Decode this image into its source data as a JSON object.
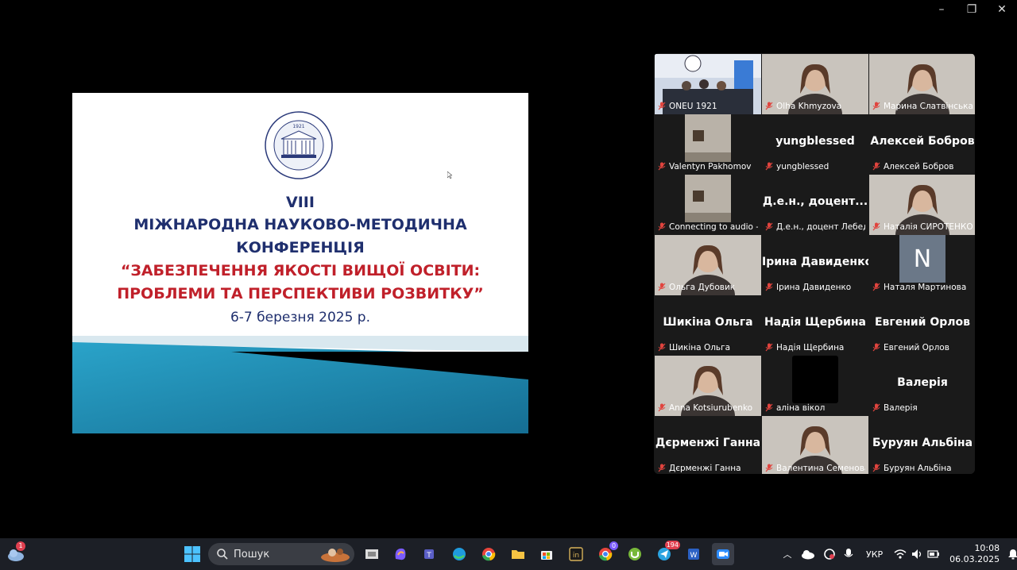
{
  "window": {
    "minimize": "–",
    "restore": "❐",
    "close": "✕"
  },
  "slide": {
    "line1": "VIII",
    "line2": "МІЖНАРОДНА НАУКОВО-МЕТОДИЧНА",
    "line3": "КОНФЕРЕНЦІЯ",
    "line4": "“ЗАБЕЗПЕЧЕННЯ ЯКОСТІ ВИЩОЇ ОСВІТИ:",
    "line5": "ПРОБЛЕМИ ТА ПЕРСПЕКТИВИ РОЗВИТКУ”",
    "line6": "6-7 березня 2025 р.",
    "seal_year": "1921"
  },
  "participants": [
    {
      "name": "ONEU 1921",
      "display": "",
      "video": "room"
    },
    {
      "name": "Olha Khmyzova",
      "display": "",
      "video": "person"
    },
    {
      "name": "Марина Слатвінська",
      "display": "",
      "video": "person"
    },
    {
      "name": "Valentyn Pakhomov",
      "display": "",
      "video": "small"
    },
    {
      "name": "yungblessed",
      "display": "yungblessed",
      "video": ""
    },
    {
      "name": "Алексей Бобров",
      "display": "Алексей Бобров",
      "video": ""
    },
    {
      "name": "Connecting to audio -...",
      "display": "",
      "video": "small"
    },
    {
      "name": "Д.е.н., доцент Лебеде...",
      "display": "Д.е.н., доцент...",
      "video": ""
    },
    {
      "name": "Наталія СИРОТЕНКО",
      "display": "",
      "video": "person"
    },
    {
      "name": "Ольга Дубовик",
      "display": "",
      "video": "person"
    },
    {
      "name": "Ірина Давиденко",
      "display": "Ірина Давиденко",
      "video": ""
    },
    {
      "name": "Наталя Мартинова",
      "display": "",
      "video": "initial",
      "initial": "N"
    },
    {
      "name": "Шикіна Ольга",
      "display": "Шикіна Ольга",
      "video": ""
    },
    {
      "name": "Надія Щербина",
      "display": "Надія Щербина",
      "video": ""
    },
    {
      "name": "Евгений Орлов",
      "display": "Евгений Орлов",
      "video": ""
    },
    {
      "name": "Anna Kotsiurubenko",
      "display": "",
      "video": "person"
    },
    {
      "name": "аліна вікол",
      "display": "",
      "video": "black"
    },
    {
      "name": "Валерія",
      "display": "Валерія",
      "video": ""
    },
    {
      "name": "Дєрменжі Ганна",
      "display": "Дєрменжі Ганна",
      "video": ""
    },
    {
      "name": "Валентина Семенова",
      "display": "",
      "video": "person"
    },
    {
      "name": "Буруян Альбіна",
      "display": "Буруян Альбіна",
      "video": ""
    }
  ],
  "taskbar": {
    "search_placeholder": "Пошук",
    "weather_badge": "1",
    "badge_chrome2": "0",
    "badge_telegram": "194",
    "lang": "УКР",
    "time": "10:08",
    "date": "06.03.2025",
    "apps": [
      "start-icon",
      "search-icon",
      "file-explorer-icon",
      "copilot-icon",
      "teams-icon",
      "edge-icon",
      "chrome-icon",
      "folder-icon",
      "store-icon",
      "indesign-icon",
      "chrome-profile-icon",
      "utorrent-icon",
      "telegram-icon",
      "word-icon",
      "zoom-icon"
    ]
  },
  "colors": {
    "active_border": "#1fd36b",
    "slide_blue": "#1f2f6e",
    "slide_red": "#c0202a",
    "mic_muted": "#e0443e"
  }
}
